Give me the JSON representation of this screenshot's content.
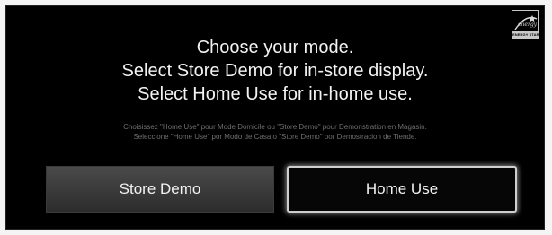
{
  "header": {
    "logo_icon": "energy-star-icon",
    "logo_text": "ENERGY STAR"
  },
  "prompt": {
    "line1": "Choose your mode.",
    "line2": "Select Store Demo for in-store display.",
    "line3": "Select Home Use for in-home use."
  },
  "translations": {
    "french": "Choisissez \"Home Use\" pour Mode Domicile ou \"Store Demo\" pour Demonstration en Magasin.",
    "spanish": "Seleccione \"Home Use\" por Modo de Casa o \"Store Demo\" por Demostracion de Tiende."
  },
  "buttons": {
    "store_demo": "Store Demo",
    "home_use": "Home Use",
    "selected": "home_use"
  },
  "colors": {
    "background": "#000000",
    "text": "#f2f2f2",
    "subtext": "#6f6f6f",
    "highlight_border": "#cfcfcf"
  }
}
